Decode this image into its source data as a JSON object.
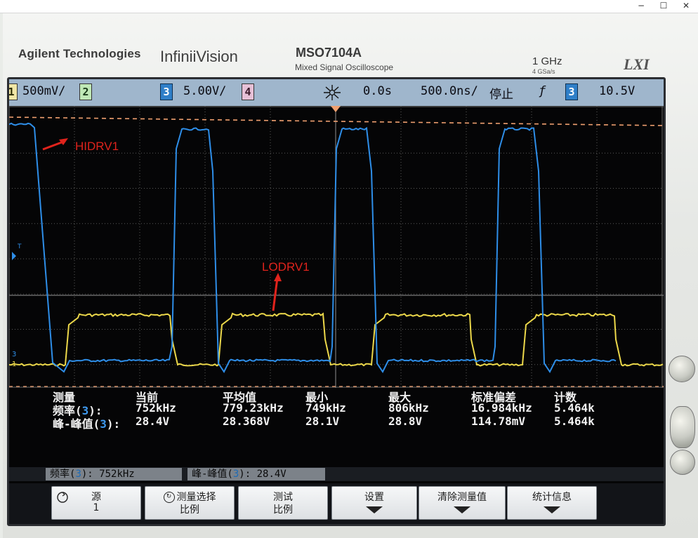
{
  "window": {
    "minimize": "−",
    "maximize": "☐",
    "close": "✕"
  },
  "brand": {
    "company": "Agilent Technologies",
    "series": "InfiniiVision",
    "model": "MSO7104A",
    "description": "Mixed Signal Oscilloscope",
    "bandwidth": "1 GHz",
    "sample_rate": "4 GSa/s",
    "logo": "LXI"
  },
  "status_bar": {
    "ch1_num": "1",
    "ch1_scale": "500mV/",
    "ch2_num": "2",
    "ch3_num": "3",
    "ch3_scale": "5.00V/",
    "ch4_num": "4",
    "time_delay": "0.0s",
    "time_scale": "500.0ns/",
    "run_state": "停止",
    "trigger_slope": "ƒ",
    "trigger_source": "3",
    "trigger_level": "10.5V"
  },
  "waveform_labels": {
    "hidrv": "HIDRV1",
    "lodrv": "LODRV1",
    "ch3_marker": "3",
    "ch1_marker": "1",
    "trigger_marker": "T"
  },
  "colors": {
    "ch1": "#ecd84a",
    "ch3": "#2e8ee8",
    "annotation": "#e0231c",
    "cursor": "#f0a070"
  },
  "measurements": {
    "headers": [
      "测量",
      "当前",
      "平均值",
      "最小",
      "最大",
      "标准偏差",
      "计数"
    ],
    "rows": [
      {
        "name_pre": "频率(",
        "ch": "3",
        "name_post": "):",
        "current": "752kHz",
        "mean": "779.23kHz",
        "min": "749kHz",
        "max": "806kHz",
        "stddev": "16.984kHz",
        "count": "5.464k"
      },
      {
        "name_pre": "峰-峰值(",
        "ch": "3",
        "name_post": "):",
        "current": "28.4V",
        "mean": "28.368V",
        "min": "28.1V",
        "max": "28.8V",
        "stddev": "114.78mV",
        "count": "5.464k"
      }
    ]
  },
  "readout": {
    "freq_pre": "频率(",
    "freq_ch": "3",
    "freq_post": "): 752kHz",
    "pp_pre": "峰-峰值(",
    "pp_ch": "3",
    "pp_post": "): 28.4V"
  },
  "softkeys": [
    {
      "line1": "源",
      "line2": "1"
    },
    {
      "line1": "测量选择",
      "line2": "比例"
    },
    {
      "line1": "测试",
      "line2": "比例"
    },
    {
      "line1": "设置",
      "line2": ""
    },
    {
      "line1": "清除测量值",
      "line2": ""
    },
    {
      "line1": "统计信息",
      "line2": ""
    }
  ]
}
